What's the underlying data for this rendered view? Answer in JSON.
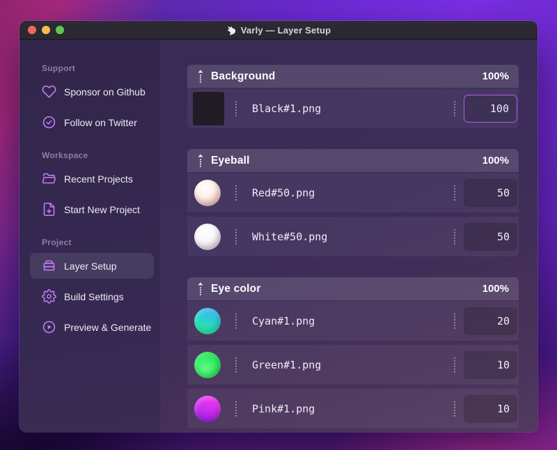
{
  "window": {
    "title": "Varly — Layer Setup",
    "app_icon": "unicorn-icon"
  },
  "sidebar": {
    "sections": [
      {
        "label": "Support",
        "items": [
          {
            "label": "Sponsor on Github",
            "icon": "heart-icon"
          },
          {
            "label": "Follow on Twitter",
            "icon": "badge-check-icon"
          }
        ]
      },
      {
        "label": "Workspace",
        "items": [
          {
            "label": "Recent Projects",
            "icon": "folder-icon"
          },
          {
            "label": "Start New Project",
            "icon": "document-plus-icon"
          }
        ]
      },
      {
        "label": "Project",
        "items": [
          {
            "label": "Layer Setup",
            "icon": "layers-box-icon",
            "active": true
          },
          {
            "label": "Build Settings",
            "icon": "gear-icon"
          },
          {
            "label": "Preview & Generate",
            "icon": "play-circle-icon"
          }
        ]
      }
    ]
  },
  "layers": [
    {
      "name": "Background",
      "weight": "100%",
      "items": [
        {
          "file": "Black#1.png",
          "value": "100",
          "thumb": "square-black",
          "thumb_colors": [
            "#221c26"
          ],
          "focused": true
        }
      ]
    },
    {
      "name": "Eyeball",
      "weight": "100%",
      "items": [
        {
          "file": "Red#50.png",
          "value": "50",
          "thumb": "sphere-red",
          "thumb_colors": [
            "#ffffff",
            "#e3bdb2"
          ]
        },
        {
          "file": "White#50.png",
          "value": "50",
          "thumb": "sphere-white",
          "thumb_colors": [
            "#ffffff",
            "#c9c4d2"
          ]
        }
      ]
    },
    {
      "name": "Eye color",
      "weight": "100%",
      "items": [
        {
          "file": "Cyan#1.png",
          "value": "20",
          "thumb": "sphere-cyan",
          "thumb_colors": [
            "#38b4fa",
            "#22e3a1"
          ]
        },
        {
          "file": "Green#1.png",
          "value": "10",
          "thumb": "sphere-green",
          "thumb_colors": [
            "#53f87d",
            "#14ce47"
          ]
        },
        {
          "file": "Pink#1.png",
          "value": "10",
          "thumb": "sphere-pink",
          "thumb_colors": [
            "#ef3cf3",
            "#9c1fe2"
          ]
        }
      ]
    }
  ],
  "colors": {
    "accent_purple": "#c57ef5",
    "focus_border": "#b45cf0",
    "group_header_bg": "#5a4a73",
    "content_bg": "#3b2c58",
    "sidebar_bg": "#342850",
    "titlebar_bg": "#2a2730",
    "desktop_violet": "#7c30e8",
    "desktop_magenta": "#d438b2",
    "traffic_red": "#ee6a5f",
    "traffic_yellow": "#f5bd4f",
    "traffic_green": "#61c554"
  }
}
